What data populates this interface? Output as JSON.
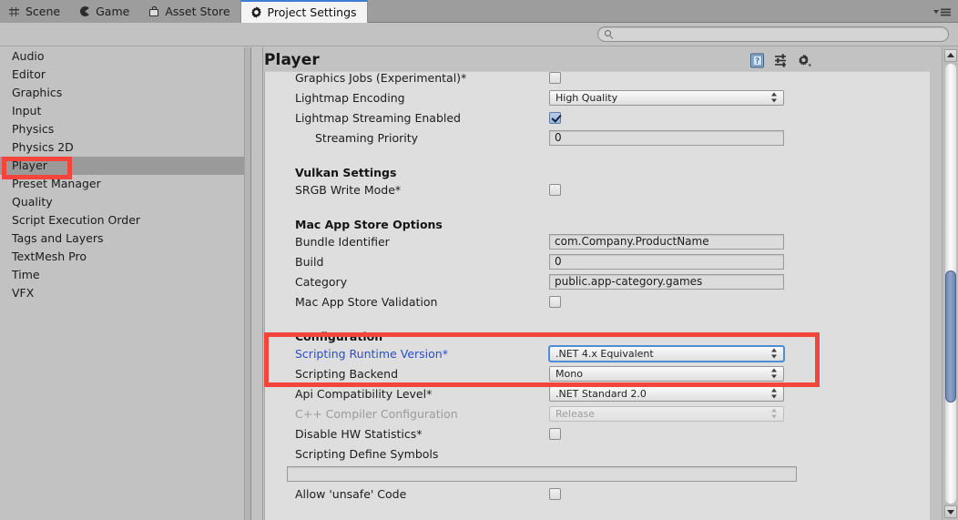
{
  "tabs": [
    {
      "label": "Scene",
      "icon": "grid-icon",
      "active": false
    },
    {
      "label": "Game",
      "icon": "pacman-icon",
      "active": false
    },
    {
      "label": "Asset Store",
      "icon": "shopping-bag-icon",
      "active": false
    },
    {
      "label": "Project Settings",
      "icon": "gear-icon",
      "active": true
    }
  ],
  "tabbar": {
    "menu_icon": "panel-menu-icon"
  },
  "search": {
    "value": "",
    "placeholder": "",
    "icon": "search-icon"
  },
  "sidebar": {
    "items": [
      {
        "label": "Audio",
        "selected": false
      },
      {
        "label": "Editor",
        "selected": false
      },
      {
        "label": "Graphics",
        "selected": false
      },
      {
        "label": "Input",
        "selected": false
      },
      {
        "label": "Physics",
        "selected": false
      },
      {
        "label": "Physics 2D",
        "selected": false
      },
      {
        "label": "Player",
        "selected": true
      },
      {
        "label": "Preset Manager",
        "selected": false
      },
      {
        "label": "Quality",
        "selected": false
      },
      {
        "label": "Script Execution Order",
        "selected": false
      },
      {
        "label": "Tags and Layers",
        "selected": false
      },
      {
        "label": "TextMesh Pro",
        "selected": false
      },
      {
        "label": "Time",
        "selected": false
      },
      {
        "label": "VFX",
        "selected": false
      }
    ]
  },
  "panel": {
    "title": "Player",
    "tools": [
      {
        "name": "help-icon"
      },
      {
        "name": "preset-icon"
      },
      {
        "name": "settings-gear-icon"
      }
    ]
  },
  "rows": [
    {
      "kind": "field",
      "label": "Graphics Jobs (Experimental)*",
      "control": "checkbox",
      "checked": false,
      "clipped": true
    },
    {
      "kind": "field",
      "label": "Lightmap Encoding",
      "control": "dropdown",
      "value": "High Quality"
    },
    {
      "kind": "field",
      "label": "Lightmap Streaming Enabled",
      "control": "checkbox",
      "checked": true
    },
    {
      "kind": "field",
      "label": "Streaming Priority",
      "control": "text",
      "value": "0",
      "indent": true
    },
    {
      "kind": "spacer"
    },
    {
      "kind": "section",
      "label": "Vulkan Settings"
    },
    {
      "kind": "field",
      "label": "SRGB Write Mode*",
      "control": "checkbox",
      "checked": false
    },
    {
      "kind": "spacer"
    },
    {
      "kind": "section",
      "label": "Mac App Store Options"
    },
    {
      "kind": "field",
      "label": "Bundle Identifier",
      "control": "text",
      "value": "com.Company.ProductName"
    },
    {
      "kind": "field",
      "label": "Build",
      "control": "text",
      "value": "0"
    },
    {
      "kind": "field",
      "label": "Category",
      "control": "text",
      "value": "public.app-category.games"
    },
    {
      "kind": "field",
      "label": "Mac App Store Validation",
      "control": "checkbox",
      "checked": false
    },
    {
      "kind": "spacer"
    },
    {
      "kind": "section",
      "label": "Configuration"
    },
    {
      "kind": "field",
      "label": "Scripting Runtime Version*",
      "control": "dropdown",
      "value": ".NET 4.x Equivalent",
      "highlight": true,
      "focus": true
    },
    {
      "kind": "field",
      "label": "Scripting Backend",
      "control": "dropdown",
      "value": "Mono"
    },
    {
      "kind": "field",
      "label": "Api Compatibility Level*",
      "control": "dropdown",
      "value": ".NET Standard 2.0"
    },
    {
      "kind": "field",
      "label": "C++ Compiler Configuration",
      "control": "dropdown",
      "value": "Release",
      "disabled": true
    },
    {
      "kind": "field",
      "label": "Disable HW Statistics*",
      "control": "checkbox",
      "checked": false
    },
    {
      "kind": "field",
      "label": "Scripting Define Symbols",
      "control": "none"
    },
    {
      "kind": "field",
      "label": "",
      "control": "text-wide",
      "value": ""
    },
    {
      "kind": "field",
      "label": "Allow 'unsafe' Code",
      "control": "checkbox",
      "checked": false
    }
  ],
  "annotations": {
    "sidebar_box": {
      "name": "player-highlight-box",
      "color": "#f4453c"
    },
    "config_box": {
      "name": "scripting-runtime-highlight-box",
      "color": "#f4453c"
    }
  },
  "scrollbar": {
    "thumb_top_pct": 47,
    "thumb_height_pct": 30
  }
}
